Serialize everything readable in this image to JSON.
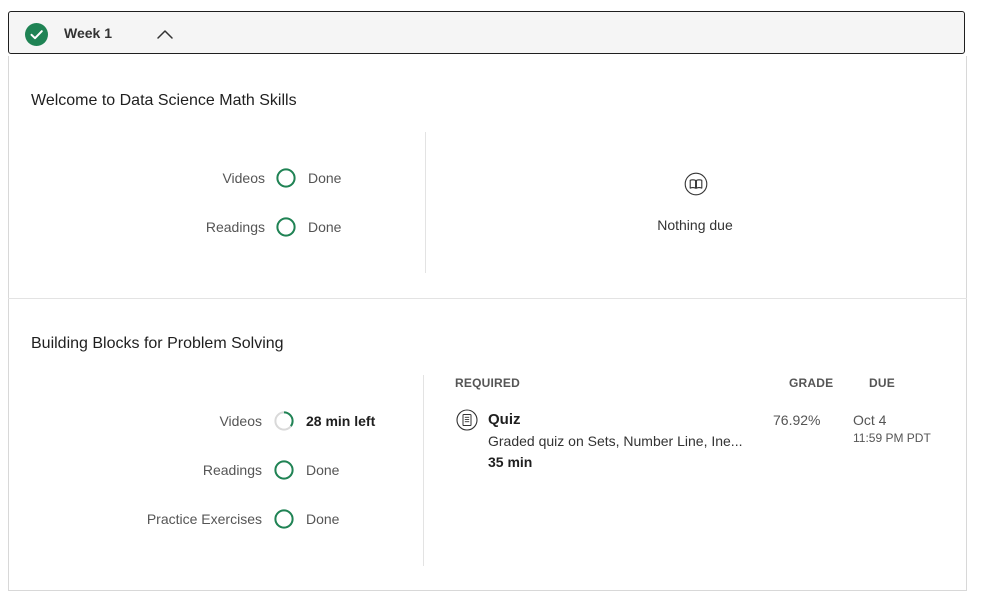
{
  "week": {
    "title": "Week 1",
    "completed": true
  },
  "sections": [
    {
      "title": "Welcome to Data Science Math Skills",
      "progress": [
        {
          "label": "Videos",
          "status": "Done",
          "fraction": 1.0
        },
        {
          "label": "Readings",
          "status": "Done",
          "fraction": 1.0
        }
      ],
      "due": {
        "icon": "book-icon",
        "text": "Nothing due"
      }
    },
    {
      "title": "Building Blocks for Problem Solving",
      "progress": [
        {
          "label": "Videos",
          "status": "28 min left",
          "fraction": 0.35
        },
        {
          "label": "Readings",
          "status": "Done",
          "fraction": 1.0
        },
        {
          "label": "Practice Exercises",
          "status": "Done",
          "fraction": 1.0
        }
      ],
      "table": {
        "headers": {
          "required": "REQUIRED",
          "grade": "GRADE",
          "due": "DUE"
        },
        "items": [
          {
            "icon": "quiz-icon",
            "title": "Quiz",
            "description": "Graded quiz on Sets, Number Line, Ine...",
            "duration": "35 min",
            "grade": "76.92%",
            "due_date": "Oct 4",
            "due_time": "11:59 PM PDT"
          }
        ]
      }
    }
  ],
  "colors": {
    "accent": "#1f8354",
    "ring_track": "#d9d9d9"
  }
}
